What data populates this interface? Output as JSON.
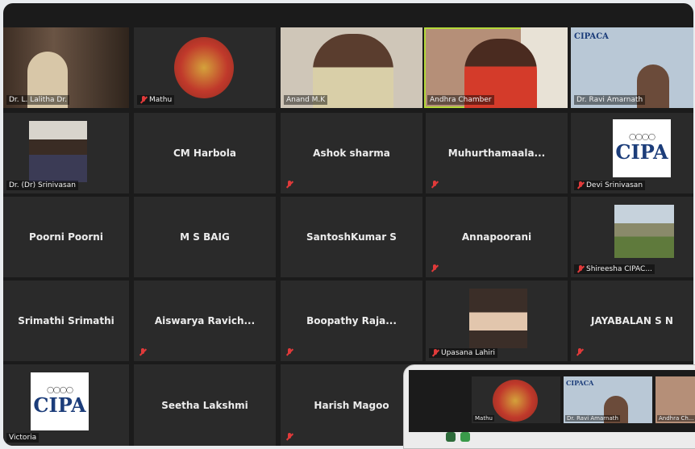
{
  "video_tiles": [
    {
      "label": "Dr. L. Lalitha Dr."
    },
    {
      "label": "Mathu"
    },
    {
      "label": "Anand M.K"
    },
    {
      "label": "Andhra Chamber"
    },
    {
      "label": "Dr. Ravi Amarnath"
    },
    {
      "label": "Dr. (Dr) Srinivasan"
    },
    {
      "label": "Devi Srinivasan"
    },
    {
      "label": "Shireesha CIPAC..."
    },
    {
      "label": "Upasana Lahiri"
    },
    {
      "label": "Victoria"
    }
  ],
  "name_tiles": [
    {
      "name": "CM Harbola"
    },
    {
      "name": "Ashok sharma"
    },
    {
      "name": "Muhurthamaala..."
    },
    {
      "name": "Poorni Poorni"
    },
    {
      "name": "M S BAIG"
    },
    {
      "name": "SantoshKumar S"
    },
    {
      "name": "Annapoorani"
    },
    {
      "name": "Srimathi Srimathi"
    },
    {
      "name": "Aiswarya Ravich..."
    },
    {
      "name": "Boopathy Raja..."
    },
    {
      "name": "JAYABALAN S N"
    },
    {
      "name": "Seetha Lakshmi"
    },
    {
      "name": "Harish Magoo"
    }
  ],
  "logos": {
    "cipa": "CIPA",
    "cipaca": "CIPACA"
  },
  "sub_window": {
    "tiles": [
      {
        "label": "Mathu"
      },
      {
        "label": "Dr. Ravi Amarnath"
      },
      {
        "label": "Andhra Ch..."
      }
    ]
  },
  "colors": {
    "background": "#1b1b1b",
    "tile": "#2a2a2a",
    "active_speaker": "#b5d93a",
    "muted_icon": "#e03a3a"
  }
}
